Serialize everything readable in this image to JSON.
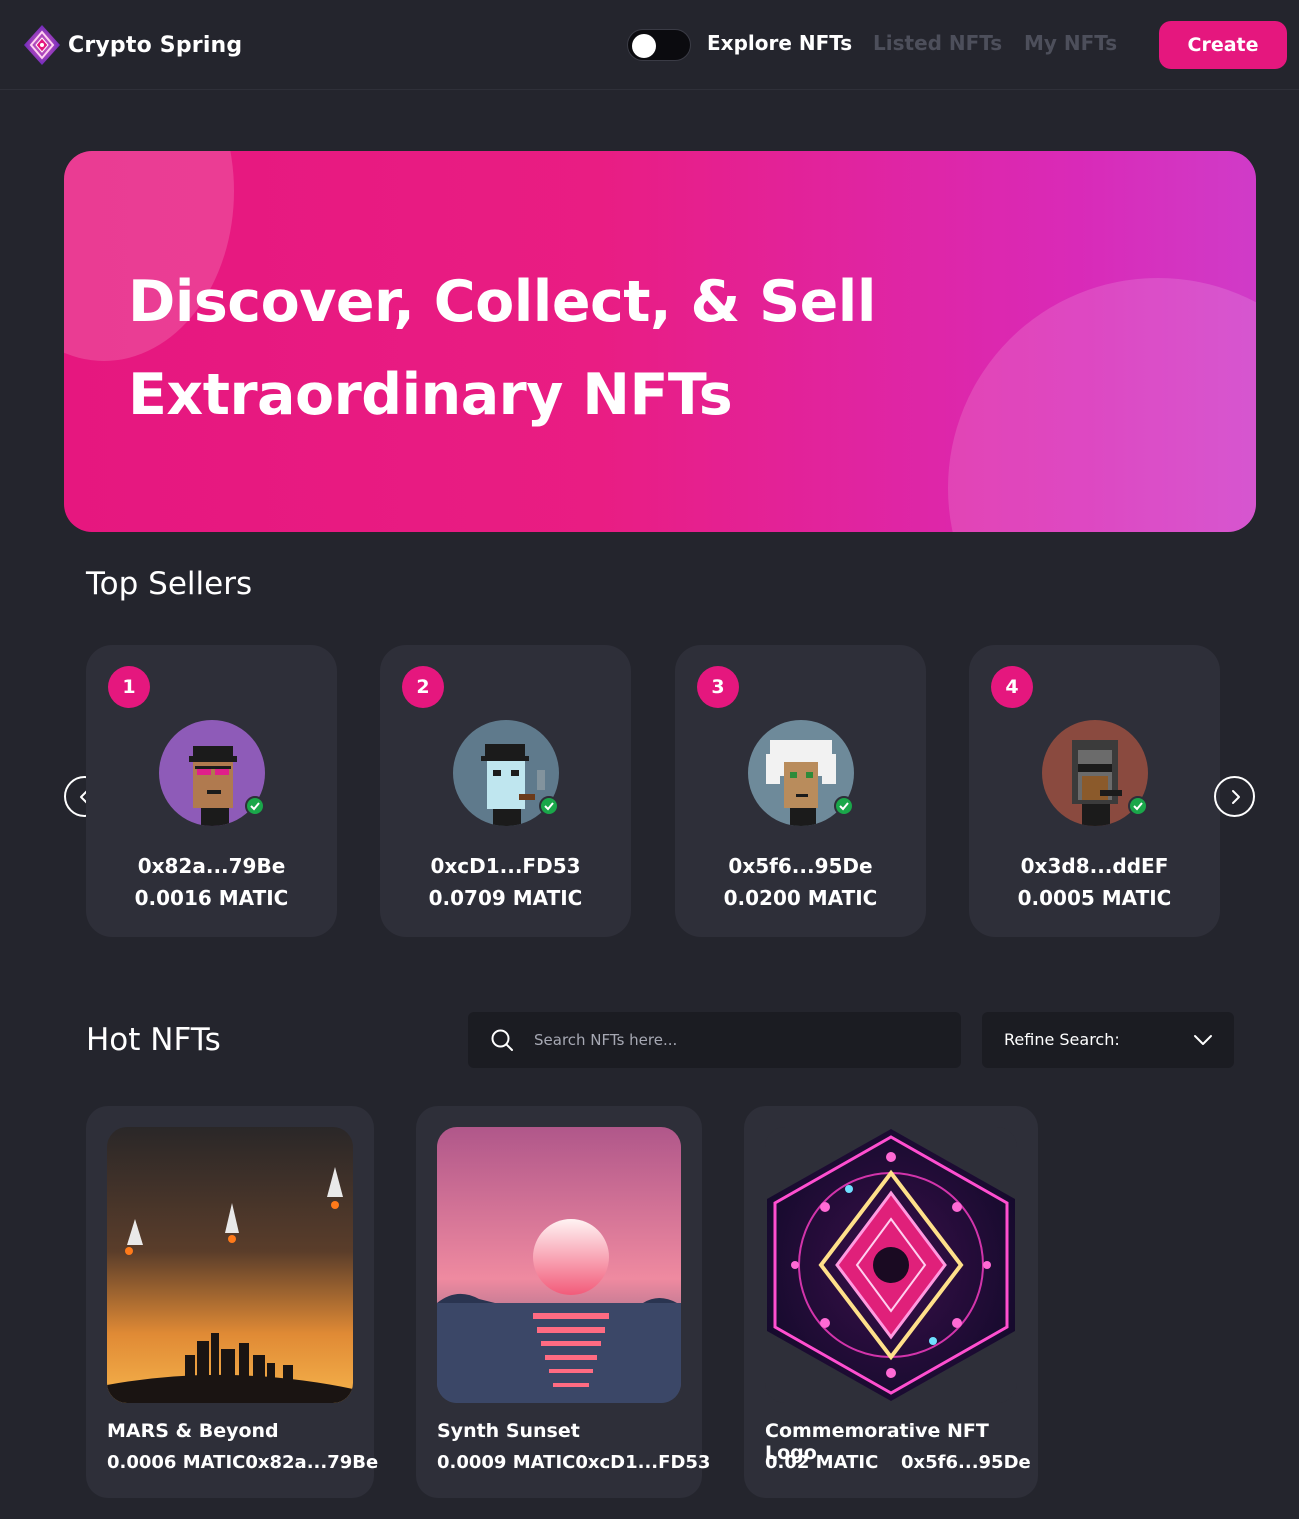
{
  "brand": {
    "name": "Crypto Spring",
    "logo_icon": "diamond-logo-icon"
  },
  "nav": {
    "theme_toggle": {
      "state": "dark",
      "icon": "moon-icon"
    },
    "links": [
      {
        "label": "Explore NFTs",
        "active": true
      },
      {
        "label": "Listed NFTs",
        "active": false
      },
      {
        "label": "My NFTs",
        "active": false
      }
    ],
    "create_label": "Create"
  },
  "hero": {
    "line1": "Discover, Collect, & Sell",
    "line2": "Extraordinary NFTs"
  },
  "top_sellers": {
    "title": "Top Sellers",
    "sellers": [
      {
        "rank": "1",
        "address": "0x82a...79Be",
        "amount": "0.0016 MATIC"
      },
      {
        "rank": "2",
        "address": "0xcD1...FD53",
        "amount": "0.0709 MATIC"
      },
      {
        "rank": "3",
        "address": "0x5f6...95De",
        "amount": "0.0200 MATIC"
      },
      {
        "rank": "4",
        "address": "0x3d8...ddEF",
        "amount": "0.0005 MATIC"
      }
    ]
  },
  "hot_nfts": {
    "title": "Hot NFTs",
    "search_placeholder": "Search NFTs here...",
    "refine_label": "Refine Search:",
    "items": [
      {
        "name": "MARS & Beyond",
        "price_owner": "0.0006 MATIC0x82a...79Be"
      },
      {
        "name": "Synth Sunset",
        "price_owner": "0.0009 MATIC0xcD1...FD53"
      },
      {
        "name": "Commemorative NFT Logo",
        "price": "0.02 MATIC",
        "owner": "0x5f6...95De"
      }
    ]
  },
  "colors": {
    "background": "#24252d",
    "card": "#2e2f39",
    "accent": "#e5177e",
    "muted_link": "#4d4f5b",
    "verified": "#1aa74a"
  }
}
